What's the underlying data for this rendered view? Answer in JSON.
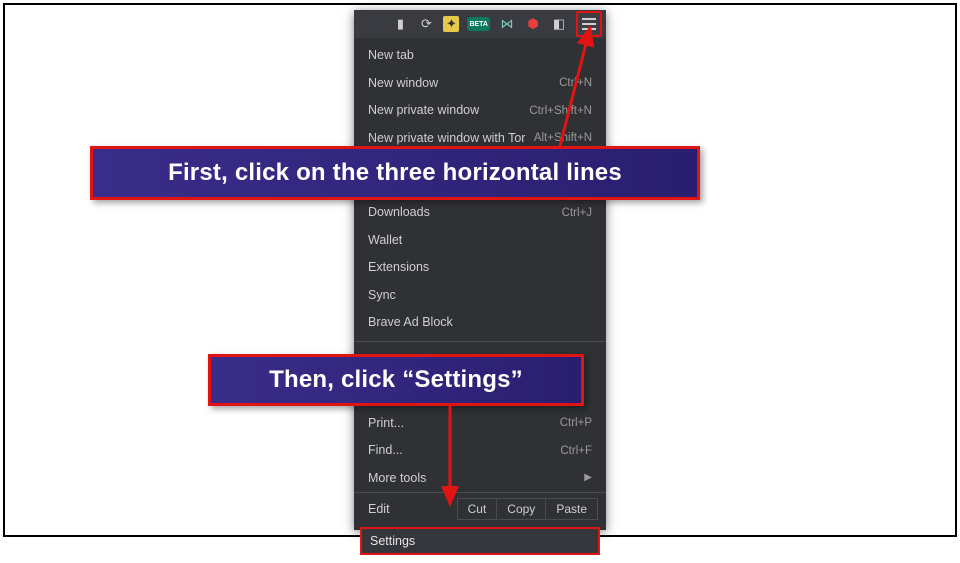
{
  "toolbar": {
    "icons": [
      "play-icon",
      "refresh-icon",
      "app-icon",
      "beta-badge",
      "next-icon",
      "shield-icon",
      "more-icon"
    ],
    "beta_label": "BETA"
  },
  "menu": {
    "group1": [
      {
        "label": "New tab",
        "shortcut": ""
      },
      {
        "label": "New window",
        "shortcut": "Ctrl+N"
      },
      {
        "label": "New private window",
        "shortcut": "Ctrl+Shift+N"
      },
      {
        "label": "New private window with Tor",
        "shortcut": "Alt+Shift+N"
      }
    ],
    "group2": [
      {
        "label": "Downloads",
        "shortcut": "Ctrl+J"
      },
      {
        "label": "Wallet",
        "shortcut": ""
      },
      {
        "label": "Extensions",
        "shortcut": ""
      },
      {
        "label": "Sync",
        "shortcut": ""
      },
      {
        "label": "Brave Ad Block",
        "shortcut": ""
      }
    ],
    "group3": [
      {
        "label": "Print...",
        "shortcut": "Ctrl+P"
      },
      {
        "label": "Find...",
        "shortcut": "Ctrl+F"
      },
      {
        "label": "More tools",
        "shortcut": "",
        "submenu": true
      }
    ],
    "edit_row": {
      "label": "Edit",
      "cut": "Cut",
      "copy": "Copy",
      "paste": "Paste"
    },
    "settings_label": "Settings"
  },
  "callouts": {
    "first": "First, click on the three horizontal lines",
    "second": "Then, click “Settings”"
  }
}
